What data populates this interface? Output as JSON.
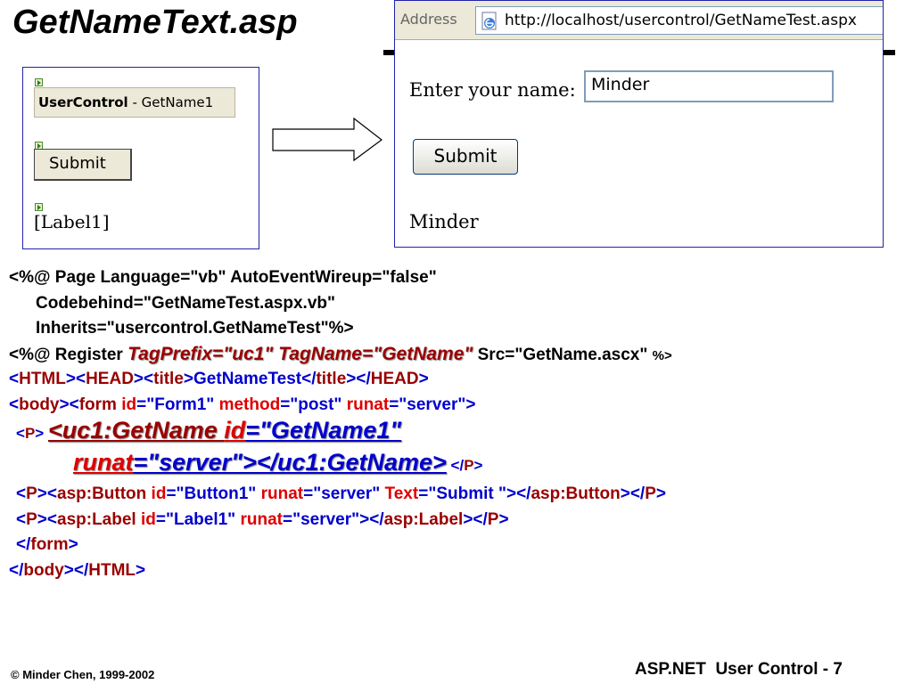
{
  "slide": {
    "title": "GetNameText.asp",
    "footer_left": "© Minder Chen, 1999-2002",
    "footer_right": "ASP.NET  User Control - 7"
  },
  "designer": {
    "usercontrol_bold": "UserControl",
    "usercontrol_rest": " - GetName1",
    "submit_label": "Submit",
    "label_text": "[Label1]"
  },
  "browser": {
    "address_label": "Address",
    "url": "http://localhost/usercontrol/GetNameTest.aspx",
    "prompt_label": "Enter your name:",
    "name_value": "Minder",
    "submit_label": "Submit",
    "result_text": "Minder"
  },
  "code": {
    "l1": "<%@ Page Language=\"vb\" AutoEventWireup=\"false\"",
    "l2": "Codebehind=\"GetNameTest.aspx.vb\"",
    "l3": "Inherits=\"usercontrol.GetNameTest\"%>",
    "l4a": "<%@ Register ",
    "l4b": "TagPrefix=\"uc1\" TagName=\"GetName\"",
    "l4c": " Src=\"GetName.ascx\" ",
    "l4d": "%>",
    "l5": {
      "a": "<",
      "b": "HTML",
      "c": "><",
      "d": "HEAD",
      "e": "><",
      "f": "title",
      "g": ">",
      "h": "GetNameTest",
      "i": "</",
      "j": "title",
      "k": "></",
      "l": "HEAD",
      "m": ">"
    },
    "l6": {
      "a": "<",
      "b": "body",
      "c": "><",
      "d": "form",
      "e": " id",
      "f": "=\"Form1\" ",
      "g": "method",
      "h": "=\"post\" ",
      "i": "runat",
      "j": "=\"server\">"
    },
    "l7": {
      "a": "<",
      "b": "P",
      "c": "> ",
      "d": "<uc1:GetName ",
      "e": "id",
      "f": "=\"GetName1\""
    },
    "l8": {
      "a": "runat",
      "b": "=\"server\"></uc1:GetName>",
      "c": " </",
      "d": "P",
      "e": ">"
    },
    "l9": {
      "a": "<",
      "b": "P",
      "c": "><",
      "d": "asp:Button ",
      "e": "id",
      "f": "=\"Button1\" ",
      "g": "runat",
      "h": "=\"server\" ",
      "i": "Text",
      "j": "=\"Submit \"></",
      "k": "asp:Button",
      "l": "></",
      "m": "P",
      "n": ">"
    },
    "l10": {
      "a": "<",
      "b": "P",
      "c": "><",
      "d": "asp:Label ",
      "e": "id",
      "f": "=\"Label1\" ",
      "g": "runat",
      "h": "=\"server\"></",
      "i": "asp:Label",
      "j": "></",
      "k": "P",
      "l": ">"
    },
    "l11": {
      "a": "</",
      "b": "form",
      "c": ">"
    },
    "l12": {
      "a": "</",
      "b": "body",
      "c": "></",
      "d": "HTML",
      "e": ">"
    }
  },
  "colors": {
    "tag_name": "#990000",
    "attribute": "#dd0000",
    "punctuation": "#0000cc",
    "panel_border": "#2222aa"
  }
}
